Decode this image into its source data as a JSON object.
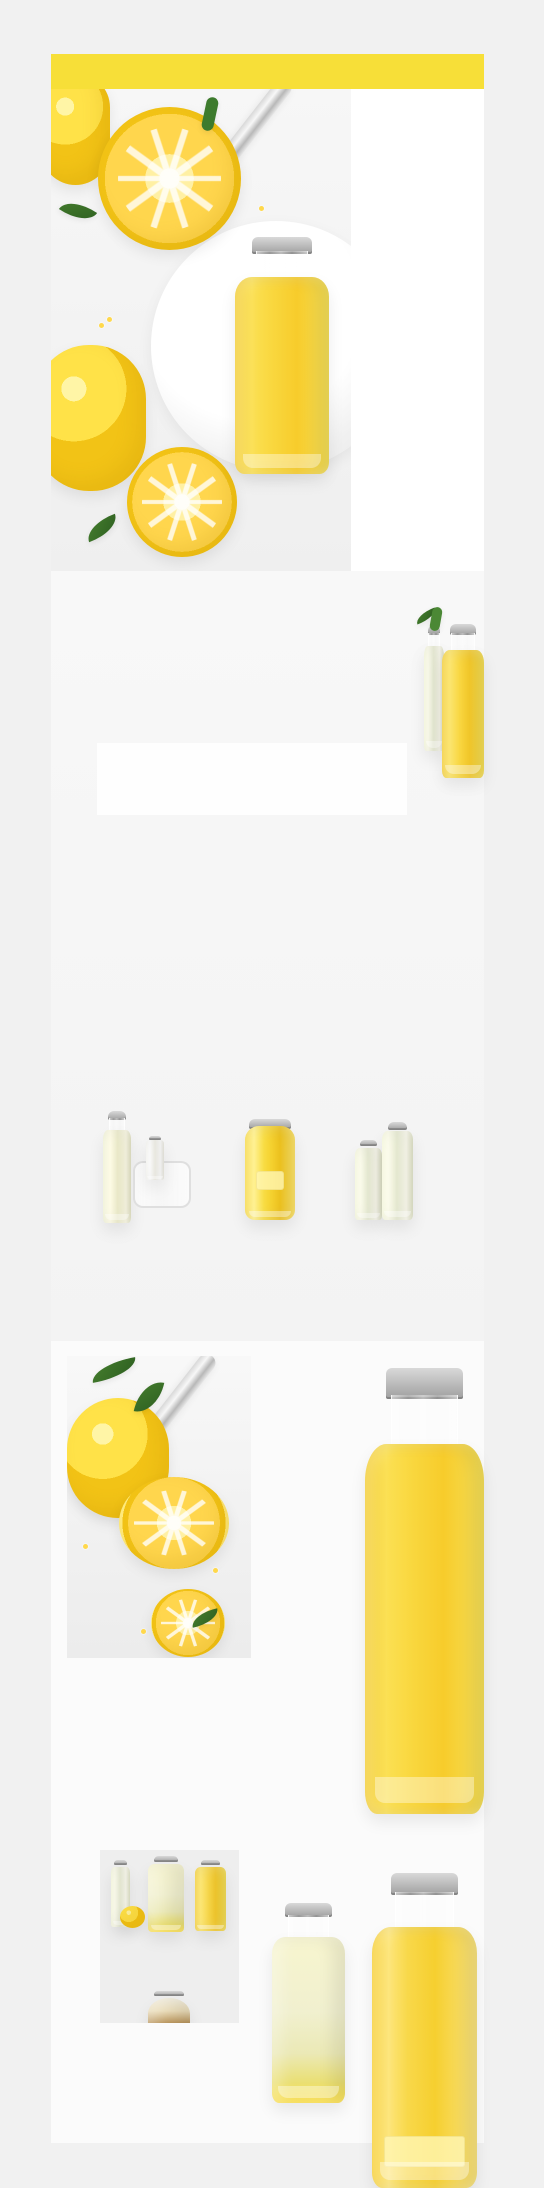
{
  "page": {
    "background_color": "#f1f1f1",
    "accent_color": "#f7df38"
  },
  "hero": {
    "image_subject": "lemons-spoon-bottle",
    "side_panel_color": "#ffffff"
  },
  "middle": {
    "top_right_subject": "two-lemonade-bottles",
    "product_row": [
      {
        "name": "lemon-bottle-with-glass"
      },
      {
        "name": "lemon-jar"
      },
      {
        "name": "pair-of-pale-bottles"
      }
    ]
  },
  "lower": {
    "left_photo_subject": "lemons-spoon-scene",
    "large_bottle_subject": "tall-lemonade-bottle",
    "collage_subject": "lemonade-collage",
    "bottom_products": [
      {
        "name": "pale-lemonade-bottle"
      },
      {
        "name": "cloudy-lemonade-bottle"
      }
    ]
  }
}
